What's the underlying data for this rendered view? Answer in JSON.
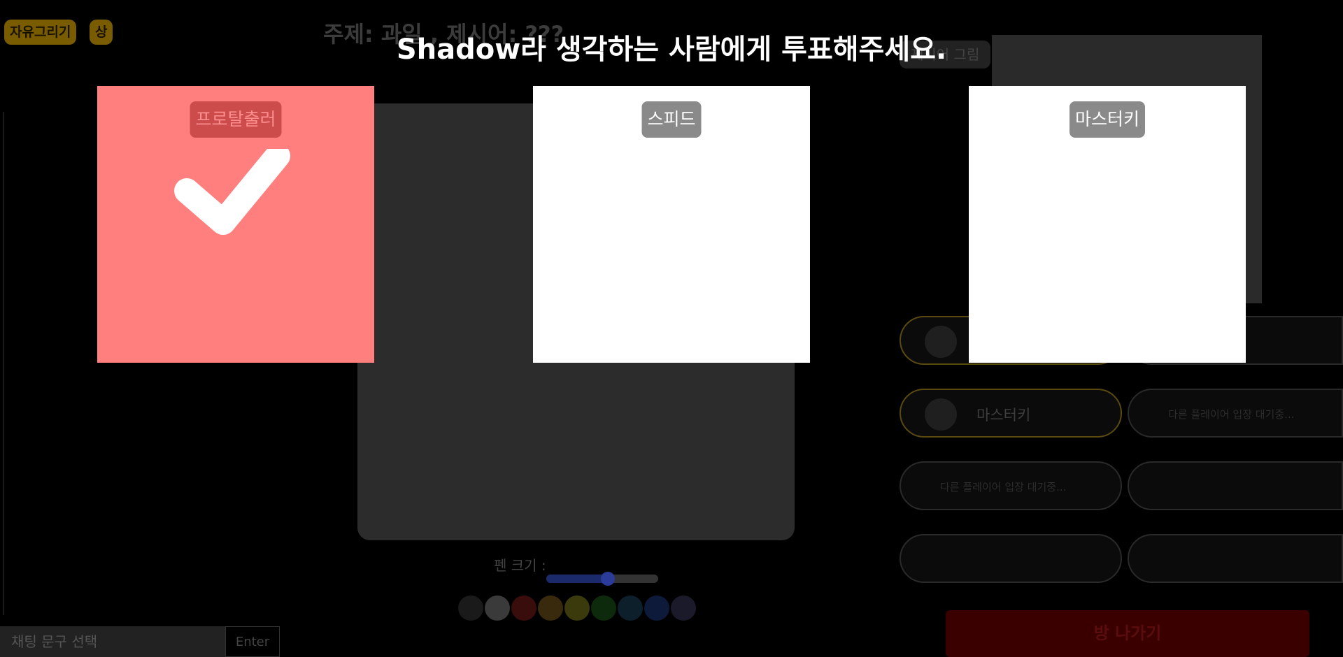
{
  "background": {
    "mode_badge": "자유그리기",
    "difficulty_badge": "상",
    "topic": "주제: 과일 , 제시어: ???",
    "pen_size_label": "펜 크기 :",
    "pen_size_level": 0.55,
    "palette_colors": [
      "#1a1a1a",
      "#3a3a3a",
      "#3a0d0d",
      "#3a2a0d",
      "#3a3a0d",
      "#0d2a0d",
      "#0d1f2a",
      "#0d1a3a",
      "#1a1a2a"
    ],
    "chat_select_placeholder": "채팅 문구 선택",
    "chat_enter_label": "Enter",
    "reference_label": "제시어 그림",
    "players": [
      {
        "name": "프로탈출러"
      },
      {
        "name": "스피드"
      },
      {
        "name": "마스터키"
      }
    ],
    "waiting_text": "다른 플레이어 입장 대기중...",
    "exit_button": "방 나가기"
  },
  "overlay": {
    "title": "Shadow라 생각하는 사람에게 투표해주세요.",
    "candidates": [
      {
        "name": "프로탈출러",
        "selected": true
      },
      {
        "name": "스피드",
        "selected": false
      },
      {
        "name": "마스터키",
        "selected": false
      }
    ],
    "colors": {
      "selected_card": "#ff7f7f",
      "card": "#ffffff",
      "name_badge": "#8a8a8a"
    }
  }
}
